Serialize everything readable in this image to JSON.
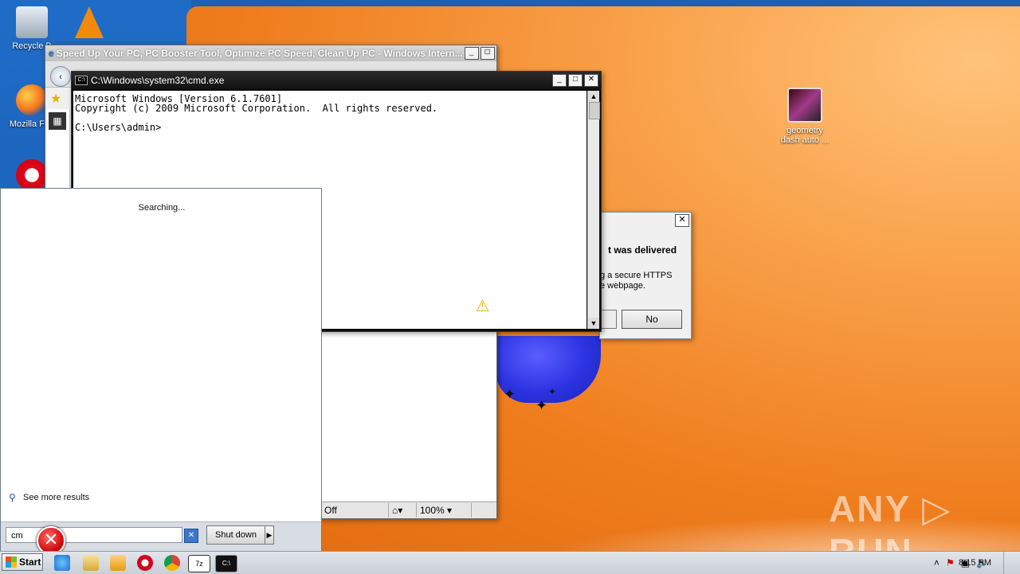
{
  "desktop": {
    "icons": [
      {
        "label": "Recycle B",
        "icon": "recycle-bin-icon"
      },
      {
        "label": "Mozilla Fire",
        "icon": "firefox-icon"
      },
      {
        "label": "geometry dash auto ...",
        "icon": "geometry-dash-icon"
      }
    ]
  },
  "ie_window": {
    "title": "Speed Up Your PC, PC Booster Tool, Optimize PC Speed, Clean Up PC - Windows Intern...",
    "status": {
      "protected_mode": "Off",
      "zoom": "100%"
    }
  },
  "cmd_window": {
    "title": "C:\\Windows\\system32\\cmd.exe",
    "lines": [
      "Microsoft Windows [Version 6.1.7601]",
      "Copyright (c) 2009 Microsoft Corporation.  All rights reserved.",
      "",
      "C:\\Users\\admin>"
    ]
  },
  "security_dialog": {
    "heading": "t was delivered",
    "body_line1": "g a secure HTTPS",
    "body_line2": "e webpage.",
    "no_button": "No",
    "close": "✕"
  },
  "start_menu": {
    "status": "Searching...",
    "see_more": "See more results",
    "search_value": "cm",
    "shutdown_label": "Shut down"
  },
  "taskbar": {
    "start_label": "Start",
    "clock": "8:15 PM"
  },
  "watermark": "ANY ▷ RUN"
}
